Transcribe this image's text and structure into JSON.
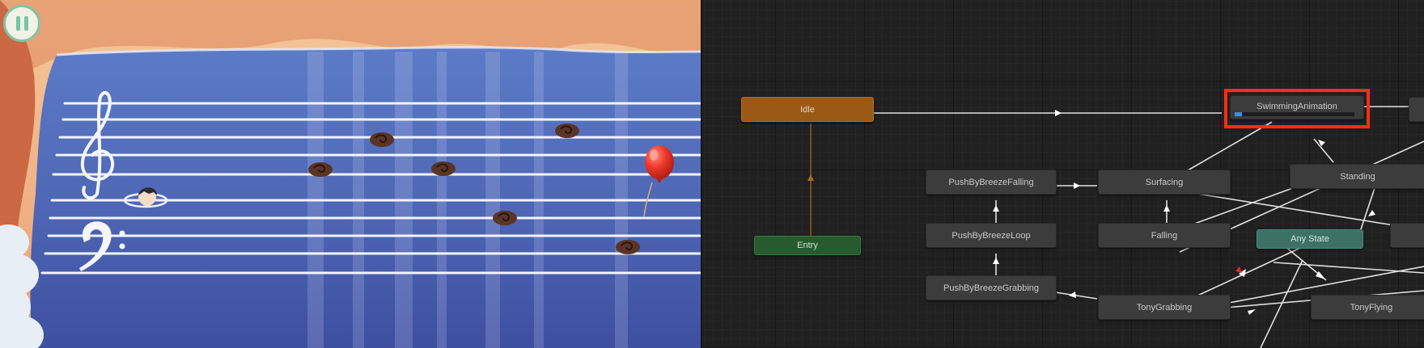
{
  "game": {
    "pause_icon": "pause-icon"
  },
  "animator": {
    "states": {
      "idle": "Idle",
      "entry": "Entry",
      "any_state": "Any State",
      "swimming": "SwimmingAnimation",
      "push_falling": "PushByBreezeFalling",
      "push_loop": "PushByBreezeLoop",
      "push_grabbing": "PushByBreezeGrabbing",
      "surfacing": "Surfacing",
      "falling": "Falling",
      "standing": "Standing",
      "tony_grabbing": "TonyGrabbing",
      "tony_flying": "TonyFlying"
    },
    "active_state_progress": 0.06,
    "highlight_color": "#ff2d12"
  }
}
